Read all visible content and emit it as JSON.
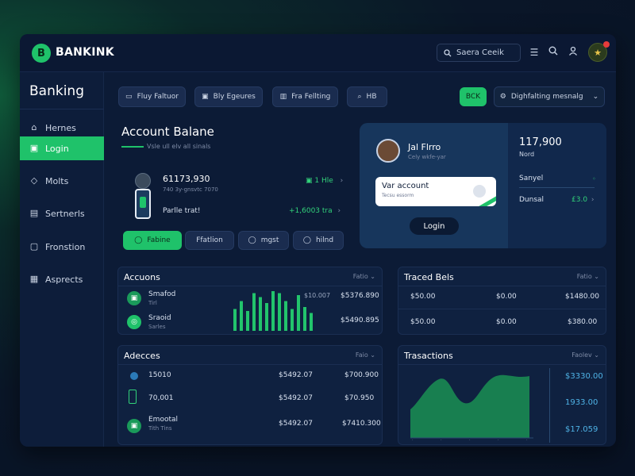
{
  "app": {
    "brand": "BANKINK",
    "logo_letter": "B"
  },
  "topbar": {
    "search_text": "Saera Ceeik"
  },
  "sidebar": {
    "title": "Banking",
    "items": [
      {
        "label": "Hernes",
        "icon": "home-icon"
      },
      {
        "label": "Login",
        "icon": "wallet-icon",
        "active": true
      },
      {
        "label": "Molts",
        "icon": "tag-icon"
      },
      {
        "label": "Sertnerls",
        "icon": "card-icon"
      },
      {
        "label": "Fronstion",
        "icon": "document-icon"
      },
      {
        "label": "Asprects",
        "icon": "calendar-icon"
      }
    ]
  },
  "toolbar": {
    "buttons": [
      "Fluy Faltuor",
      "Bly Egeures",
      "Fra Fellting",
      "HB"
    ],
    "green_button": "BCK",
    "dropdown": "Dighfalting mesnalg"
  },
  "account": {
    "title": "Account Balane",
    "subtitle": "Vsle ull elv all sinals",
    "balance": "61173,930",
    "balance_sub": "740 3y-gnsvtc 7070",
    "balance_right": "1 Hle",
    "purchase_label": "Parlle trat!",
    "purchase_value": "+1,6003 tra",
    "actions": [
      "Fabine",
      "Ffatlion",
      "mgst",
      "hilnd"
    ]
  },
  "profile": {
    "name": "Jal Flrro",
    "sub": "Cely wkfe-yar",
    "card_title": "Var account",
    "card_sub": "Tecsu essorm",
    "login_button": "Login",
    "amount": "117,900",
    "amount_label": "Nord",
    "sarvey": "Sanyel",
    "durrel": "Dunsal",
    "durrel_value": "£3.0"
  },
  "accounts_panel": {
    "title": "Accuons",
    "filter": "Fatio",
    "rows": [
      {
        "name": "Smafod",
        "sub": "Tirl",
        "v1": "$10.007",
        "v2": "$5376.890"
      },
      {
        "name": "Sraoid",
        "sub": "Sarles",
        "v1": "",
        "v2": "$5490.895"
      }
    ],
    "bars": [
      22,
      30,
      20,
      38,
      34,
      28,
      40,
      38,
      30,
      22,
      36,
      24,
      18
    ]
  },
  "traced_panel": {
    "title": "Traced Bels",
    "filter": "Fatio",
    "rows": [
      {
        "a": "$50.00",
        "b": "$0.00",
        "c": "$1480.00"
      },
      {
        "a": "$50.00",
        "b": "$0.00",
        "c": "$380.00"
      }
    ]
  },
  "adjects_panel": {
    "title": "Adecces",
    "filter": "Faio",
    "rows": [
      {
        "name": "15010",
        "sub": "",
        "v1": "$5492.07",
        "v2": "$700.900"
      },
      {
        "name": "70,001",
        "sub": "",
        "v1": "$5492.07",
        "v2": "$70.950"
      },
      {
        "name": "Emootal",
        "sub": "Tith Tins",
        "v1": "$5492.07",
        "v2": "$7410.300"
      }
    ]
  },
  "transactions_panel": {
    "title": "Trasactions",
    "filter": "Faolev",
    "values": [
      "$3330.00",
      "1933.00",
      "$17.059"
    ]
  },
  "colors": {
    "accent": "#1fc26a",
    "bg": "#0c1b36",
    "panel": "#0f2140",
    "blue": "#4fb3e6"
  }
}
